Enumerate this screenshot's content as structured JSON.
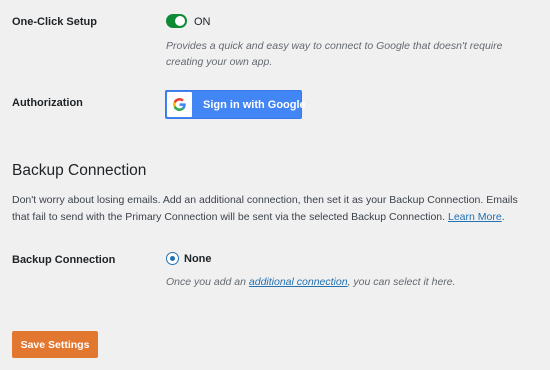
{
  "setup": {
    "label": "One-Click Setup",
    "toggle_state": "ON",
    "description": "Provides a quick and easy way to connect to Google that doesn't require creating your own app."
  },
  "authorization": {
    "label": "Authorization",
    "button_label": "Sign in with Google",
    "button_color": "#4285f4"
  },
  "backup": {
    "heading": "Backup Connection",
    "paragraph": "Don't worry about losing emails. Add an additional connection, then set it as your Backup Connection. Emails that fail to send with the Primary Connection will be sent via the selected Backup Connection.",
    "learn_more": "Learn More",
    "field_label": "Backup Connection",
    "option_none": "None",
    "note_prefix": "Once you add an",
    "note_link": "additional connection",
    "note_suffix": ", you can select it here."
  },
  "save_label": "Save Settings",
  "colors": {
    "toggle_on": "#0f8a35",
    "link": "#2271b1",
    "save_button": "#e27730",
    "background": "#f0f0f1"
  }
}
